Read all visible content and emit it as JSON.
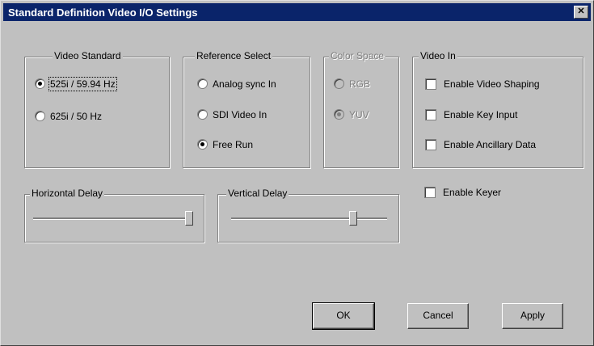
{
  "window": {
    "title": "Standard Definition Video I/O Settings",
    "close_glyph": "✕"
  },
  "video_standard": {
    "label": "Video Standard",
    "options": [
      {
        "label": "525i / 59.94 Hz",
        "checked": true
      },
      {
        "label": "625i / 50 Hz",
        "checked": false
      }
    ]
  },
  "reference_select": {
    "label": "Reference Select",
    "options": [
      {
        "label": "Analog sync In",
        "checked": false
      },
      {
        "label": "SDI Video In",
        "checked": false
      },
      {
        "label": "Free Run",
        "checked": true
      }
    ]
  },
  "color_space": {
    "label": "Color Space",
    "disabled": true,
    "options": [
      {
        "label": "RGB",
        "checked": false
      },
      {
        "label": "YUV",
        "checked": true
      }
    ]
  },
  "video_in": {
    "label": "Video In",
    "checkboxes": [
      {
        "label": "Enable Video Shaping",
        "checked": false
      },
      {
        "label": "Enable Key Input",
        "checked": false
      },
      {
        "label": "Enable Ancillary Data",
        "checked": false
      }
    ]
  },
  "horizontal_delay": {
    "label": "Horizontal Delay",
    "level": 1.0
  },
  "vertical_delay": {
    "label": "Vertical Delay",
    "level": 0.8
  },
  "enable_keyer": {
    "label": "Enable Keyer",
    "checked": false
  },
  "buttons": {
    "ok": "OK",
    "cancel": "Cancel",
    "apply": "Apply"
  }
}
